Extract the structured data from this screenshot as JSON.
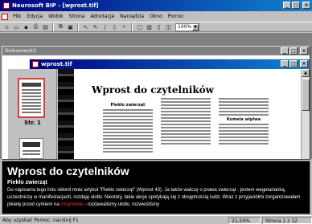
{
  "app": {
    "title": "Neurosoft BIP - [wprost.tif]",
    "window_buttons": [
      "_",
      "□",
      "×"
    ]
  },
  "menu": [
    "Plik",
    "Edycja",
    "Widok",
    "Strona",
    "Adnotacje",
    "Narzędzia",
    "Okno",
    "Pomoc"
  ],
  "toolbar": {
    "icons": [
      "new-icon",
      "open-icon",
      "save-icon",
      "print-icon",
      "scan-icon",
      "copy-icon",
      "paste-icon",
      "select-icon",
      "pen-icon",
      "line-icon",
      "highlight-icon",
      "zoom-region-icon",
      "fit-page-icon",
      "fit-width-icon",
      "single-page-icon",
      "two-page-icon"
    ],
    "zoom": "100%"
  },
  "doc2": {
    "title": "Dokument2"
  },
  "wprost": {
    "title": "wprost.tif"
  },
  "thumbnails": {
    "page1_label": "Str. 1"
  },
  "page": {
    "heading": "Wprost do czytelników",
    "col1_title": "Piekło zwierząt",
    "col3_title": "Komela wiplwa"
  },
  "text_panel": {
    "heading": "Wprost do czytelników",
    "subheading": "Piekło zwierząt",
    "body_1": "Do napisania tego listu skłonił mnie artykuł \"Piekło zwierząt\" (Wprost 43). Ja także walczę o prawa zwierząt - jestem wegetarianką, uczestniczę w manifestacjach, rozdaję ulotki. Niestety, takie akcje spotykają się z obojętnością ludzi. Wraz z przyjaciółmi zorganizowałam pikietę przed cyrkiem na ",
    "body_hl": "Ursynowie",
    "body_2": " - rozdawaliśmy ulotki, rozwieśliśmy"
  },
  "status": {
    "hint": "Aby uzyskać Pomoc, naciśnij F1",
    "zoom": "21,50%",
    "page": "Strona 1 z 12"
  }
}
